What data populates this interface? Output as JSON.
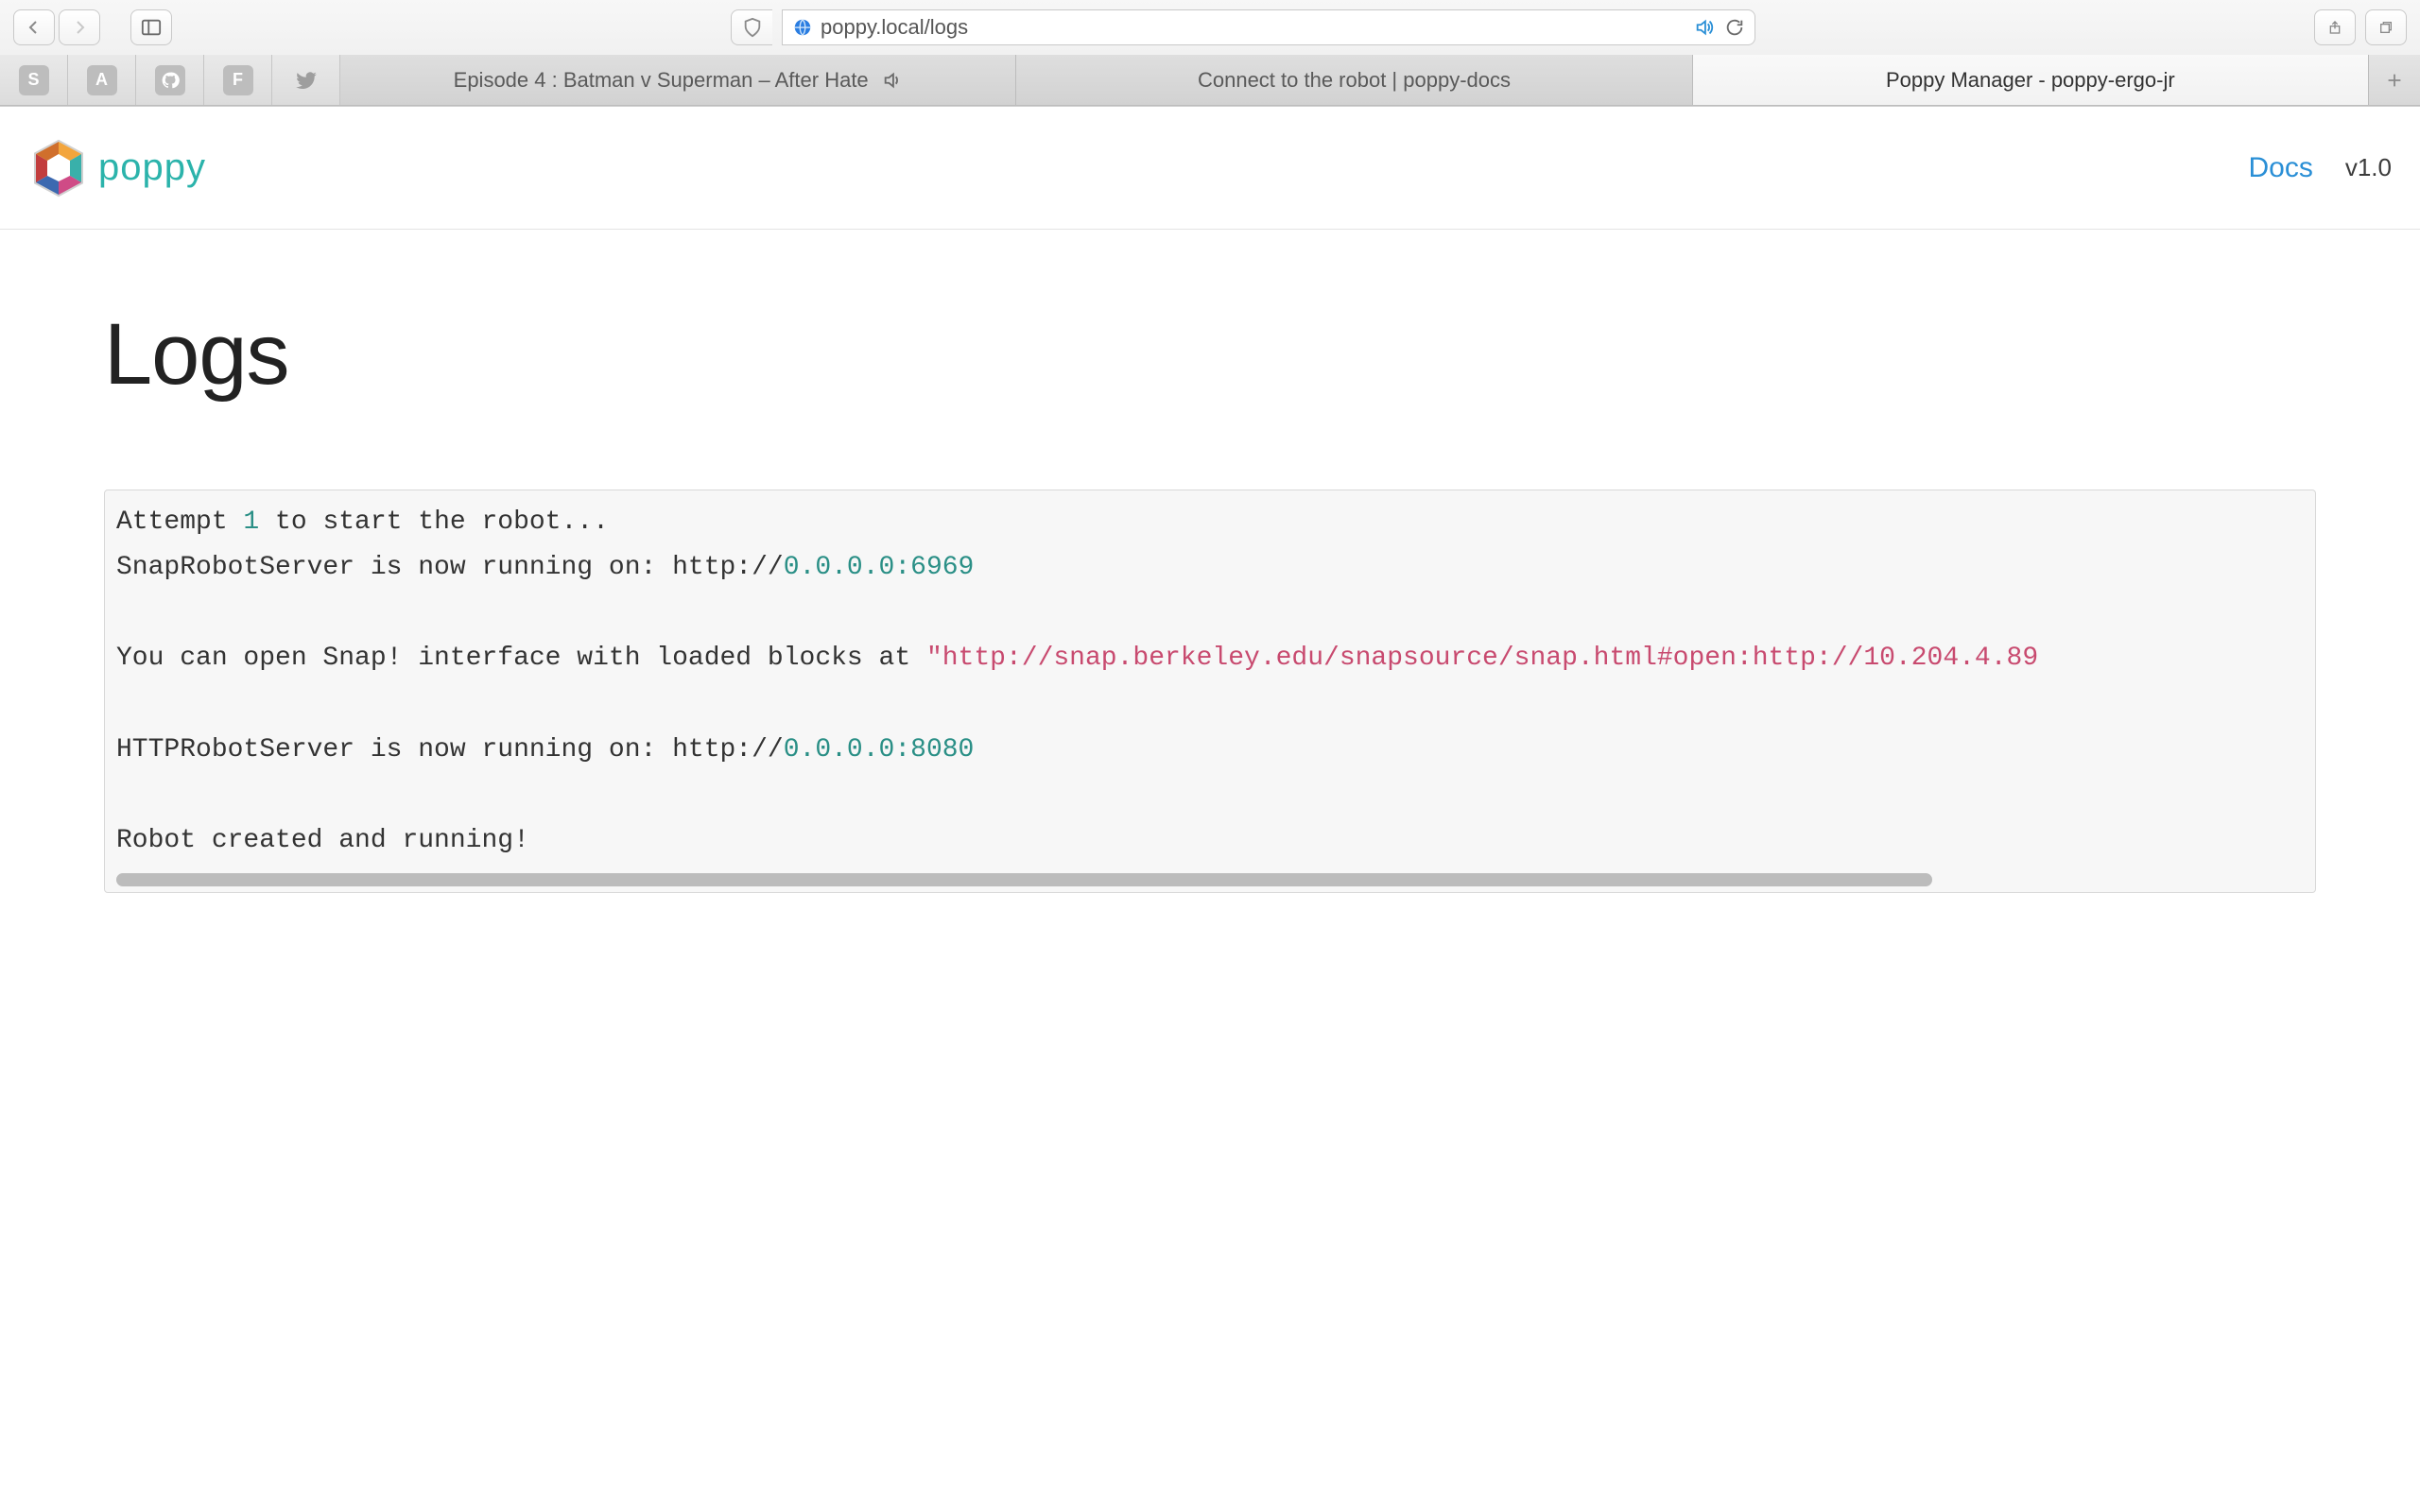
{
  "browser": {
    "url": "poppy.local/logs",
    "favorites": [
      {
        "label": "S"
      },
      {
        "label": "A"
      },
      {
        "label": "github"
      },
      {
        "label": "F"
      },
      {
        "label": "twitter"
      }
    ],
    "tabs": [
      {
        "title": "Episode 4 : Batman v Superman – After Hate",
        "audio": true,
        "active": false
      },
      {
        "title": "Connect to the robot | poppy-docs",
        "audio": false,
        "active": false
      },
      {
        "title": "Poppy Manager - poppy-ergo-jr",
        "audio": false,
        "active": true
      }
    ]
  },
  "header": {
    "brand": "poppy",
    "docs_label": "Docs",
    "version": "v1.0"
  },
  "page": {
    "title": "Logs"
  },
  "logs": {
    "l1_a": "Attempt ",
    "l1_num": "1",
    "l1_b": " to start the robot...",
    "l2_a": "SnapRobotServer is now running on: http://",
    "l2_url": "0.0.0.0:6969",
    "l3": "",
    "l4_a": "You can open Snap! interface with loaded blocks at ",
    "l4_str": "\"http://snap.berkeley.edu/snapsource/snap.html#open:http://10.204.4.89",
    "l5": "",
    "l6_a": "HTTPRobotServer is now running on: http://",
    "l6_url": "0.0.0.0:8080",
    "l7": "",
    "l8": "Robot created and running!"
  }
}
